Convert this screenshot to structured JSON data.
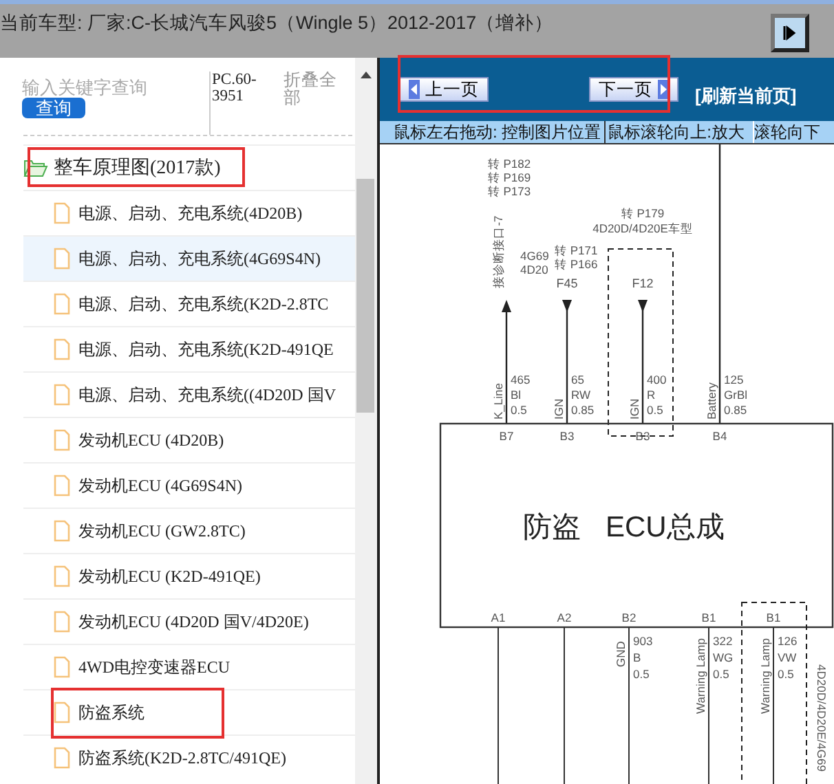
{
  "title_bar": {
    "text": "当前车型:  厂家:C-长城汽车风骏5（Wingle 5）2012-2017（增补）"
  },
  "sidebar": {
    "search": {
      "placeholder": "输入关键字查询"
    },
    "search_button": "查询",
    "code": "PC.60-3951",
    "collapse": "折叠全部",
    "tree": [
      {
        "label": "整车原理图(2017款)",
        "expanded": true,
        "children": [
          {
            "label": "电源、启动、充电系统(4D20B)",
            "selected": false
          },
          {
            "label": "电源、启动、充电系统(4G69S4N)",
            "selected": true
          },
          {
            "label": "电源、启动、充电系统(K2D-2.8TC",
            "selected": false
          },
          {
            "label": "电源、启动、充电系统(K2D-491QE",
            "selected": false
          },
          {
            "label": "电源、启动、充电系统((4D20D 国V",
            "selected": false
          },
          {
            "label": "发动机ECU (4D20B)",
            "selected": false
          },
          {
            "label": "发动机ECU (4G69S4N)",
            "selected": false
          },
          {
            "label": "发动机ECU (GW2.8TC)",
            "selected": false
          },
          {
            "label": "发动机ECU (K2D-491QE)",
            "selected": false
          },
          {
            "label": "发动机ECU (4D20D 国V/4D20E)",
            "selected": false
          },
          {
            "label": "4WD电控变速器ECU",
            "selected": false
          },
          {
            "label": "防盗系统",
            "selected": false
          },
          {
            "label": "防盗系统(K2D-2.8TC/491QE)",
            "selected": false
          }
        ]
      }
    ]
  },
  "viewer": {
    "prev_button": "上一页",
    "next_button": "下一页",
    "refresh_link": "[刷新当前页]",
    "hints": [
      "鼠标左右拖动: 控制图片位置",
      "鼠标滚轮向上:放大",
      "滚轮向下"
    ],
    "diagram": {
      "module": [
        "防盗",
        "ECU总成"
      ],
      "top_wires": [
        {
          "kind": "out",
          "pin": "B7",
          "signal": "K_Line",
          "wire": [
            "465",
            "Bl",
            "0.5"
          ],
          "label": "接诊断接口-7",
          "notes": [
            "转 P182",
            "转 P169",
            "转 P173"
          ],
          "side_notes": [
            "4G69",
            "4D20"
          ]
        },
        {
          "kind": "in",
          "pin": "B3",
          "signal": "IGN",
          "wire": [
            "65",
            "RW",
            "0.85"
          ],
          "label": "F45",
          "notes": [
            "转 P171",
            "转 P166"
          ]
        },
        {
          "kind": "in",
          "pin": "B3",
          "signal": "IGN",
          "wire": [
            "400",
            "R",
            "0.5"
          ],
          "label": "F12",
          "notes": [
            "转 P179",
            "4D20D/4D20E车型"
          ],
          "optional": true
        },
        {
          "kind": "through",
          "pin": "B4",
          "signal": "Battery",
          "wire": [
            "125",
            "GrBl",
            "0.85"
          ]
        }
      ],
      "bottom_wires": [
        {
          "pin": "A1"
        },
        {
          "pin": "A2"
        },
        {
          "pin": "B2",
          "signal": "GND",
          "wire": [
            "903",
            "B",
            "0.5"
          ]
        },
        {
          "pin": "B1",
          "signal": "Warning Lamp",
          "wire": [
            "322",
            "WG",
            "0.5"
          ]
        },
        {
          "pin": "B1",
          "signal": "Warning Lamp",
          "wire": [
            "126",
            "VW",
            "0.5"
          ],
          "optional": true,
          "variant": "4D20D/4D20E/4G69"
        }
      ]
    }
  }
}
